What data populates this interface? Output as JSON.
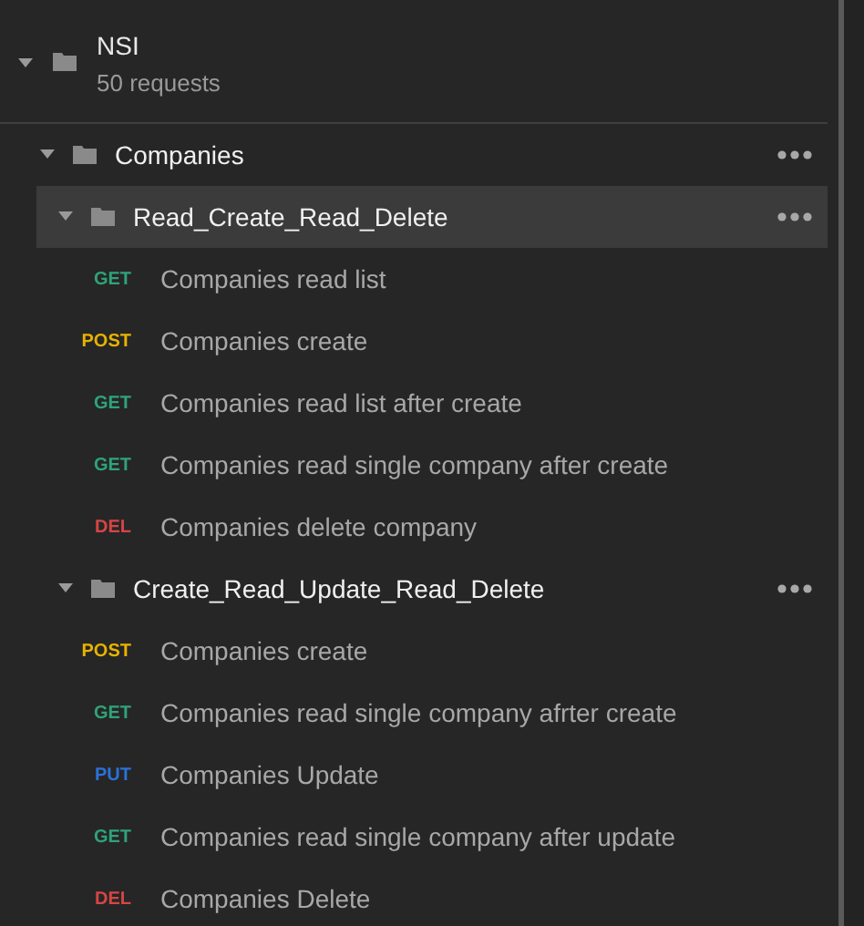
{
  "collection": {
    "name": "NSI",
    "subtitle": "50 requests",
    "expanded": true,
    "children": [
      {
        "kind": "folder",
        "name": "Companies",
        "expanded": true,
        "selected": false,
        "children": [
          {
            "kind": "folder",
            "name": "Read_Create_Read_Delete",
            "expanded": true,
            "selected": true,
            "children": [
              {
                "kind": "request",
                "method": "GET",
                "name": "Companies read list",
                "selected": false
              },
              {
                "kind": "request",
                "method": "POST",
                "name": "Companies create",
                "selected": false
              },
              {
                "kind": "request",
                "method": "GET",
                "name": "Companies read list after create",
                "selected": false
              },
              {
                "kind": "request",
                "method": "GET",
                "name": "Companies read single company after create",
                "selected": false
              },
              {
                "kind": "request",
                "method": "DEL",
                "name": "Companies delete company",
                "selected": false
              }
            ]
          },
          {
            "kind": "folder",
            "name": "Create_Read_Update_Read_Delete",
            "expanded": true,
            "selected": false,
            "children": [
              {
                "kind": "request",
                "method": "POST",
                "name": "Companies create",
                "selected": false
              },
              {
                "kind": "request",
                "method": "GET",
                "name": "Companies read single company afrter create",
                "selected": false
              },
              {
                "kind": "request",
                "method": "PUT",
                "name": "Companies Update",
                "selected": false
              },
              {
                "kind": "request",
                "method": "GET",
                "name": "Companies read single company after update",
                "selected": false
              },
              {
                "kind": "request",
                "method": "DEL",
                "name": "Companies Delete",
                "selected": false
              }
            ]
          }
        ]
      }
    ]
  }
}
